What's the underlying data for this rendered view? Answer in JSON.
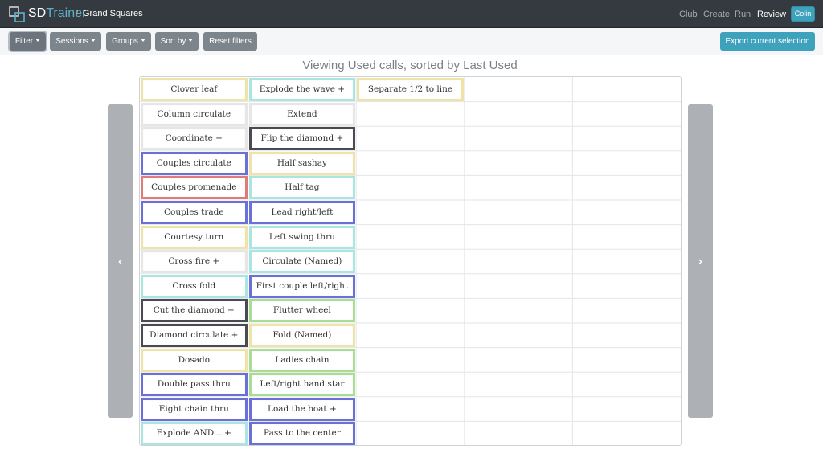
{
  "navbar": {
    "brand_sd": "SD",
    "brand_trainer": "Trainer",
    "separator": "/",
    "page_name": "Grand Squares",
    "links": [
      {
        "label": "Club",
        "active": false
      },
      {
        "label": "Create",
        "active": false
      },
      {
        "label": "Run",
        "active": false
      },
      {
        "label": "Review",
        "active": true
      }
    ],
    "user": "Colin"
  },
  "toolbar": {
    "filter": "Filter",
    "sessions": "Sessions",
    "groups": "Groups",
    "sort_by": "Sort by",
    "reset": "Reset filters",
    "export": "Export current selection"
  },
  "heading": "Viewing Used calls, sorted by Last Used",
  "nav_arrows": {
    "left": "‹",
    "right": "›"
  },
  "colors": {
    "yellow": "#efe3a8",
    "gray": "#e6e6e6",
    "blue": "#6b6fd8",
    "red": "#e07b78",
    "teal": "#a9e6e2",
    "dark": "#4a4a52",
    "green": "#a9dc94"
  },
  "columns": [
    [
      {
        "label": "Clover leaf",
        "color": "yellow"
      },
      {
        "label": "Column circulate",
        "color": "gray"
      },
      {
        "label": "Coordinate +",
        "color": "gray"
      },
      {
        "label": "Couples circulate",
        "color": "blue"
      },
      {
        "label": "Couples promenade",
        "color": "red"
      },
      {
        "label": "Couples trade",
        "color": "blue"
      },
      {
        "label": "Courtesy turn",
        "color": "yellow"
      },
      {
        "label": "Cross fire +",
        "color": "gray"
      },
      {
        "label": "Cross fold",
        "color": "teal"
      },
      {
        "label": "Cut the diamond +",
        "color": "dark"
      },
      {
        "label": "Diamond circulate +",
        "color": "dark"
      },
      {
        "label": "Dosado",
        "color": "yellow"
      },
      {
        "label": "Double pass thru",
        "color": "blue"
      },
      {
        "label": "Eight chain thru",
        "color": "blue"
      },
      {
        "label": "Explode AND... +",
        "color": "teal"
      }
    ],
    [
      {
        "label": "Explode the wave +",
        "color": "teal"
      },
      {
        "label": "Extend",
        "color": "gray"
      },
      {
        "label": "Flip the diamond +",
        "color": "dark"
      },
      {
        "label": "Half sashay",
        "color": "yellow"
      },
      {
        "label": "Half tag",
        "color": "teal"
      },
      {
        "label": "Lead right/left",
        "color": "blue"
      },
      {
        "label": "Left swing thru",
        "color": "teal"
      },
      {
        "label": "Circulate (Named)",
        "color": "teal"
      },
      {
        "label": "First couple left/right",
        "color": "blue"
      },
      {
        "label": "Flutter wheel",
        "color": "green"
      },
      {
        "label": "Fold (Named)",
        "color": "yellow"
      },
      {
        "label": "Ladies chain",
        "color": "green"
      },
      {
        "label": "Left/right hand star",
        "color": "green"
      },
      {
        "label": "Load the boat +",
        "color": "blue"
      },
      {
        "label": "Pass to the center",
        "color": "blue"
      }
    ],
    [
      {
        "label": "Separate 1/2 to line",
        "color": "yellow"
      }
    ]
  ]
}
